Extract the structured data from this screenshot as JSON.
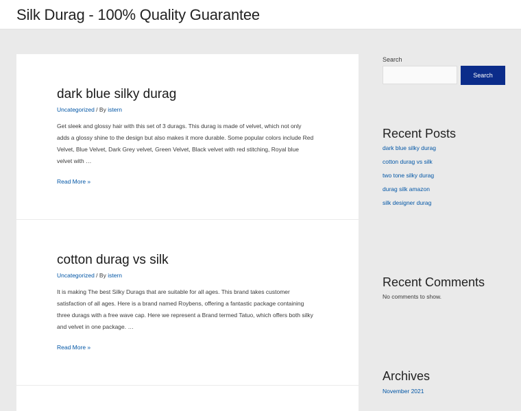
{
  "site": {
    "title": "Silk Durag - 100% Quality Guarantee"
  },
  "posts": [
    {
      "title": "dark blue silky durag",
      "category": "Uncategorized",
      "meta_sep": " / By ",
      "author": "istern",
      "excerpt": "Get sleek and glossy hair with this set of 3 durags. This durag is made of velvet, which not only adds a glossy shine to the design but also makes it more durable. Some popular colors include Red Velvet, Blue Velvet, Dark Grey velvet, Green Velvet, Black velvet with red stitching, Royal blue velvet with …",
      "read_more": "Read More »"
    },
    {
      "title": "cotton durag vs silk",
      "category": "Uncategorized",
      "meta_sep": " / By ",
      "author": "istern",
      "excerpt": "It is making The best Silky Durags that are suitable for all ages. This brand takes customer satisfaction of all ages. Here is a brand named Roybens, offering a fantastic package containing three durags with a free wave cap. Here we represent a Brand termed Tatuo, which offers both silky and velvet in one package. …",
      "read_more": "Read More »"
    }
  ],
  "sidebar": {
    "search": {
      "label": "Search",
      "value": "",
      "button_label": "Search"
    },
    "recent_posts": {
      "title": "Recent Posts",
      "items": [
        "dark blue silky durag",
        "cotton durag vs silk",
        "two tone silky durag",
        "durag silk amazon",
        "silk designer durag"
      ]
    },
    "recent_comments": {
      "title": "Recent Comments",
      "empty_text": "No comments to show."
    },
    "archives": {
      "title": "Archives",
      "items": [
        "November 2021"
      ]
    }
  },
  "colors": {
    "link": "#0256a6",
    "button": "#0b2c8a",
    "background": "#eaeaea"
  }
}
